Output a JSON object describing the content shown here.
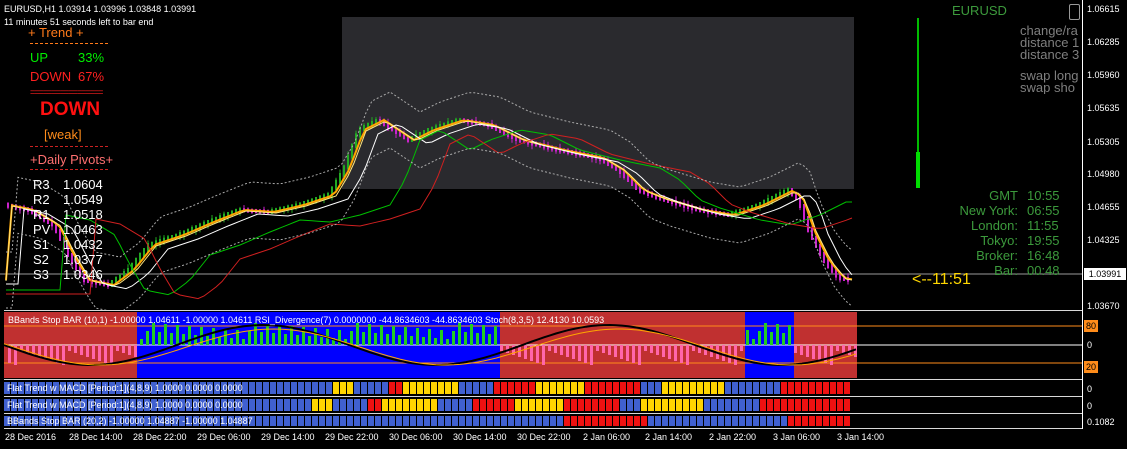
{
  "header": {
    "symbol_line": "EURUSD,H1  1.03914 1.03996 1.03848 1.03991",
    "bar_timer": "11 minutes 51 seconds left to bar end"
  },
  "trend_panel": {
    "title": "+   Trend   +",
    "up_label": "UP",
    "up_value": "33%",
    "down_label": "DOWN",
    "down_value": "67%",
    "separator": "=================",
    "direction": "DOWN",
    "strength": "[weak]",
    "pivots_title": "+Daily Pivots+",
    "pivots": [
      {
        "name": "R3",
        "value": "1.0604"
      },
      {
        "name": "R2",
        "value": "1.0549"
      },
      {
        "name": "R1",
        "value": "1.0518"
      },
      {
        "name": "PV",
        "value": "1.0463"
      },
      {
        "name": "S1",
        "value": "1.0432"
      },
      {
        "name": "S2",
        "value": "1.0377"
      },
      {
        "name": "S3",
        "value": "1.0346"
      }
    ]
  },
  "right_info": {
    "symbol": "EURUSD",
    "lines": [
      "change/ra",
      "distance 1",
      "distance 3",
      "swap long",
      "swap sho"
    ]
  },
  "clocks": [
    {
      "label": "GMT",
      "time": "10:55"
    },
    {
      "label": "New York:",
      "time": "06:55"
    },
    {
      "label": "London:",
      "time": "11:55"
    },
    {
      "label": "Tokyo:",
      "time": "19:55"
    },
    {
      "label": "Broker:",
      "time": "16:48"
    },
    {
      "label": "Bar:",
      "time": "00:48"
    }
  ],
  "countdown": "<--11:51",
  "price_scale": {
    "labels": [
      "1.06615",
      "1.06285",
      "1.05960",
      "1.05635",
      "1.05305",
      "1.04980",
      "1.04655",
      "1.04325",
      "1.03991",
      "1.03670"
    ],
    "current_price": "1.03991"
  },
  "sub_windows": {
    "bbands": {
      "caption": "BBands Stop BAR (10,1) -1.00000 1.04611 -1.00000 1.04611  RSI_Divergence(7) 0.0000000 -44.8634603 -44.8634603  Stoch(8,3,5) 12.4130 10.0593",
      "scale": [
        "80",
        "0",
        "20"
      ]
    },
    "flat1": {
      "caption": "Flat Trend w MACD [Period:1](4,8,9) 1.0000 0.0000 0.0000",
      "scale": "0"
    },
    "flat2": {
      "caption": "Flat Trend w MACD [Period:1](4,8,9) 1.0000 0.0000 0.0000",
      "scale": "0"
    },
    "bbands2": {
      "caption": "BBands Stop BAR (20,2) -1.00000 1.04887 -1.00000 1.04887",
      "scale": "0.1082"
    }
  },
  "time_axis": [
    "28 Dec 2016",
    "28 Dec 14:00",
    "28 Dec 22:00",
    "29 Dec 06:00",
    "29 Dec 14:00",
    "29 Dec 22:00",
    "30 Dec 06:00",
    "30 Dec 14:00",
    "30 Dec 22:00",
    "2 Jan 06:00",
    "2 Jan 14:00",
    "2 Jan 22:00",
    "3 Jan 06:00",
    "3 Jan 14:00"
  ],
  "colors": {
    "background": "#000000",
    "bull_candle": "#22aa22",
    "bear_candle": "#cc22cc",
    "trend_up": "#00ee00",
    "trend_down": "#ff2020",
    "info_grey": "#7f7f7f",
    "clock_green": "#3c9a3c",
    "countdown_gold": "#ffd700",
    "band_blue": "#0000ff",
    "band_red": "#c03030",
    "flat_blue": "#4060d0",
    "flat_yellow": "#ffd400",
    "flat_red": "#ee1111"
  }
}
